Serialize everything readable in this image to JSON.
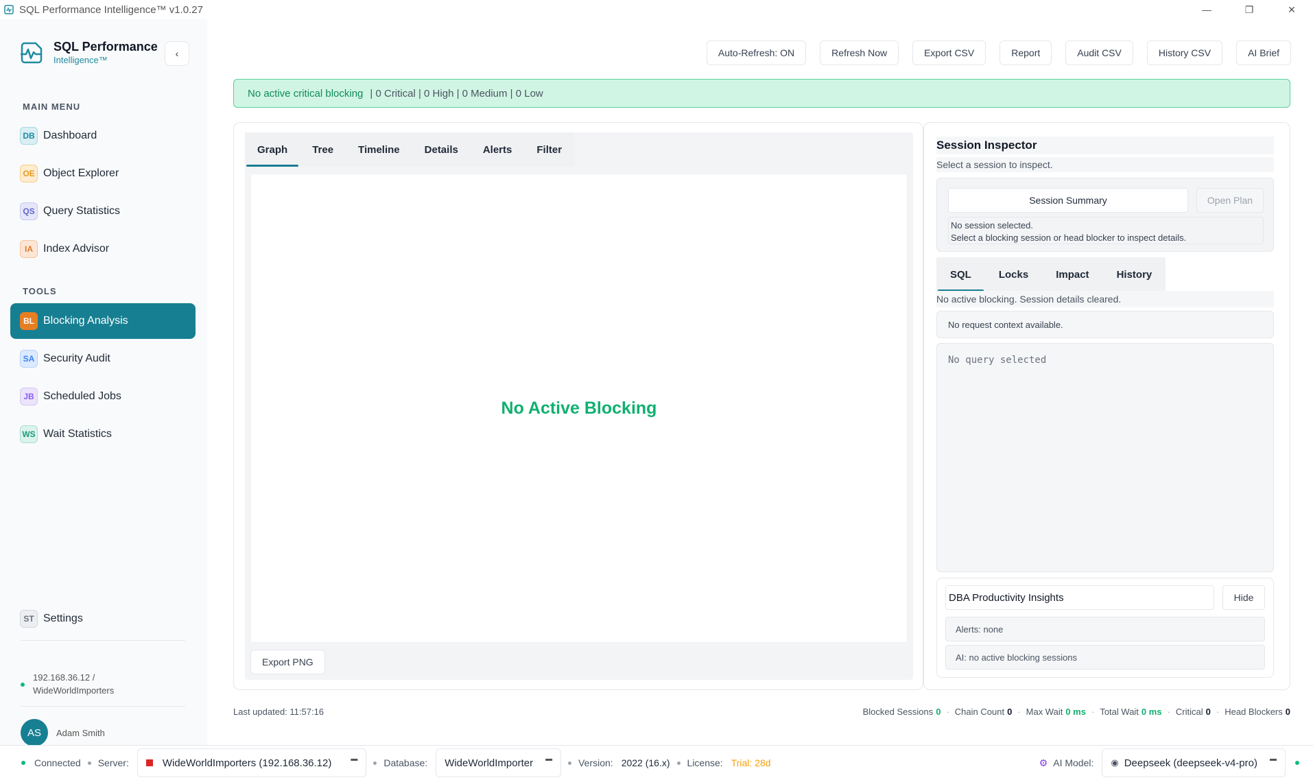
{
  "window": {
    "title": "SQL Performance Intelligence™ v1.0.27"
  },
  "brand": {
    "title": "SQL Performance",
    "subtitle": "Intelligence™"
  },
  "sidebar": {
    "main_menu_label": "MAIN MENU",
    "tools_label": "TOOLS",
    "main_items": [
      {
        "badge": "DB",
        "label": "Dashboard"
      },
      {
        "badge": "OE",
        "label": "Object Explorer"
      },
      {
        "badge": "QS",
        "label": "Query Statistics"
      },
      {
        "badge": "IA",
        "label": "Index Advisor"
      }
    ],
    "tool_items": [
      {
        "badge": "BL",
        "label": "Blocking Analysis",
        "active": true
      },
      {
        "badge": "SA",
        "label": "Security Audit"
      },
      {
        "badge": "JB",
        "label": "Scheduled Jobs"
      },
      {
        "badge": "WS",
        "label": "Wait Statistics"
      }
    ],
    "settings": {
      "badge": "ST",
      "label": "Settings"
    },
    "connection": {
      "line1": "192.168.36.12 /",
      "line2": "WideWorldImporters"
    },
    "user": {
      "initials": "AS",
      "name": "Adam Smith"
    }
  },
  "toolbar": {
    "auto_refresh": "Auto-Refresh: ON",
    "refresh_now": "Refresh Now",
    "export_csv": "Export CSV",
    "report": "Report",
    "audit_csv": "Audit CSV",
    "history_csv": "History CSV",
    "ai_brief": "AI Brief"
  },
  "alert": {
    "main": "No active critical blocking",
    "counts": "|  0 Critical | 0 High | 0 Medium | 0 Low"
  },
  "graph_panel": {
    "tabs": [
      "Graph",
      "Tree",
      "Timeline",
      "Details",
      "Alerts",
      "Filter"
    ],
    "active_tab": "Graph",
    "message": "No Active Blocking",
    "export_png": "Export PNG"
  },
  "inspector": {
    "title": "Session Inspector",
    "subtitle": "Select a session to inspect.",
    "summary_button": "Session Summary",
    "open_plan": "Open Plan",
    "msg_line1": "No session selected.",
    "msg_line2": "Select a blocking session or head blocker to inspect details.",
    "tabs": [
      "SQL",
      "Locks",
      "Impact",
      "History"
    ],
    "active_tab": "SQL",
    "status": "No active blocking. Session details cleared.",
    "context": "No request context available.",
    "query_placeholder": "No query selected",
    "insights": {
      "title": "DBA Productivity Insights",
      "hide": "Hide",
      "alerts": "Alerts: none",
      "ai": "AI: no active blocking sessions"
    }
  },
  "footer": {
    "last_updated": "Last updated: 11:57:16",
    "stats": [
      {
        "label": "Blocked Sessions",
        "value": "0",
        "color": "green"
      },
      {
        "label": "Chain Count",
        "value": "0",
        "color": "dark"
      },
      {
        "label": "Max Wait",
        "value": "0 ms",
        "color": "green"
      },
      {
        "label": "Total Wait",
        "value": "0 ms",
        "color": "green"
      },
      {
        "label": "Critical",
        "value": "0",
        "color": "dark"
      },
      {
        "label": "Head Blockers",
        "value": "0",
        "color": "dark"
      }
    ]
  },
  "statusbar": {
    "connected": "Connected",
    "server_label": "Server:",
    "server_value": "WideWorldImporters (192.168.36.12)",
    "database_label": "Database:",
    "database_value": "WideWorldImporter",
    "version_label": "Version:",
    "version_value": "2022 (16.x)",
    "license_label": "License:",
    "license_value": "Trial: 28d",
    "ai_model_label": "AI Model:",
    "ai_model_value": "Deepseek (deepseek-v4-pro)"
  },
  "colors": {
    "accent": "#177f92",
    "success": "#10b070",
    "license": "#f59e0b"
  }
}
